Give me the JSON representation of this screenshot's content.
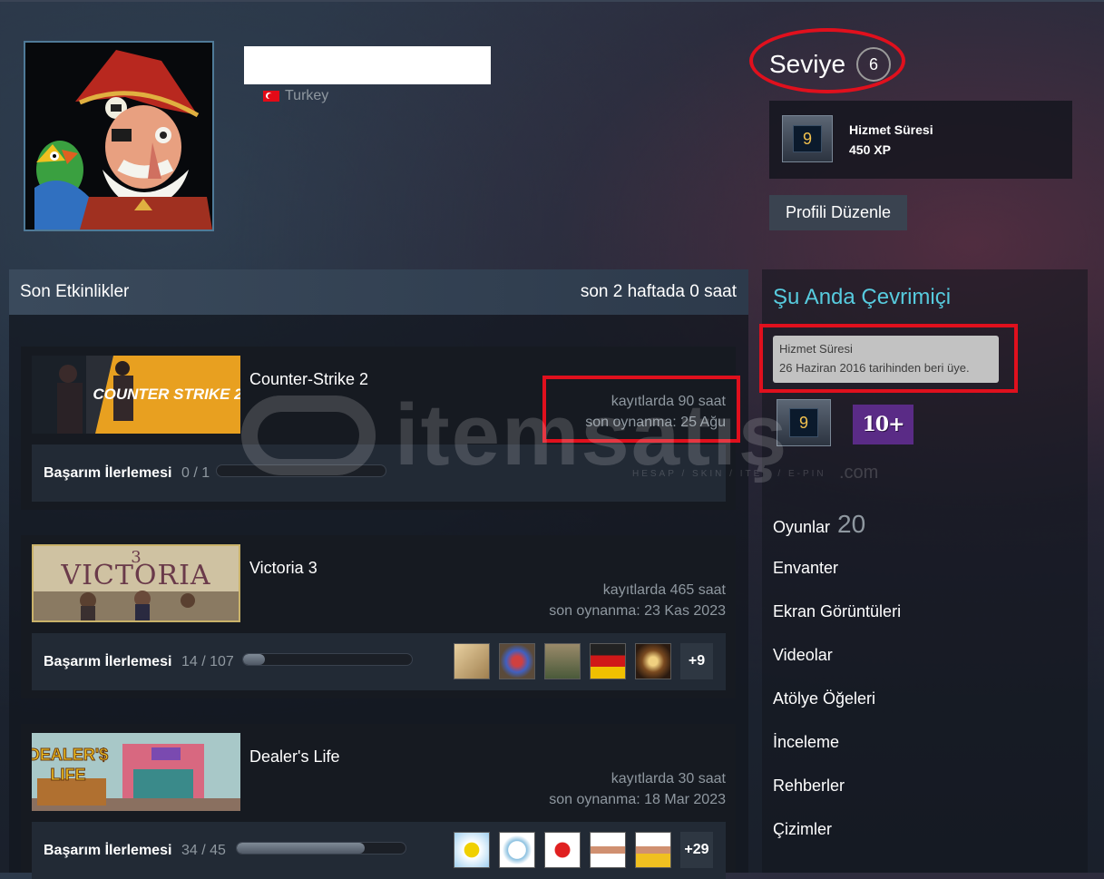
{
  "profile": {
    "country": "Turkey",
    "level_label": "Seviye",
    "level_value": "6",
    "badge": {
      "icon_text": "9",
      "title": "Hizmet Süresi",
      "xp": "450 XP"
    },
    "edit_button": "Profili Düzenle"
  },
  "activity": {
    "title": "Son Etkinlikler",
    "summary": "son 2 haftada 0 saat",
    "achievement_label": "Başarım İlerlemesi",
    "games": [
      {
        "name": "Counter-Strike 2",
        "capsule_text": "COUNTER STRIKE 2",
        "hours": "kayıtlarda 90 saat",
        "last_played": "son oynanma: 25 Ağu",
        "achievements": "0 / 1",
        "progress": 0.0,
        "more": ""
      },
      {
        "name": "Victoria 3",
        "capsule_text": "VICTORIA 3",
        "hours": "kayıtlarda 465 saat",
        "last_played": "son oynanma: 23 Kas 2023",
        "achievements": "14 / 107",
        "progress": 0.13,
        "more": "+9"
      },
      {
        "name": "Dealer's Life",
        "capsule_text": "DEALER'S LIFE",
        "hours": "kayıtlarda 30 saat",
        "last_played": "son oynanma: 18 Mar 2023",
        "achievements": "34 / 45",
        "progress": 0.76,
        "more": "+29"
      }
    ]
  },
  "sidebar": {
    "status": "Şu Anda Çevrimiçi",
    "tooltip_title": "Hizmet Süresi",
    "tooltip_text": "26 Haziran 2016 tarihinden beri üye.",
    "badge_icon_text": "9",
    "years_badge": "10+",
    "links": {
      "games": "Oyunlar",
      "games_count": "20",
      "inventory": "Envanter",
      "screenshots": "Ekran Görüntüleri",
      "videos": "Videolar",
      "workshop": "Atölye Öğeleri",
      "reviews": "İnceleme",
      "guides": "Rehberler",
      "artwork": "Çizimler"
    }
  },
  "watermark": {
    "text": "itemsatış",
    "subtitle": "HESAP / SKIN / ITEM / E-PIN",
    "suffix": ".com"
  },
  "colors": {
    "accent_online": "#57cbde",
    "highlight_red": "#e0101d",
    "level_badge_purple": "#5a2b86"
  }
}
